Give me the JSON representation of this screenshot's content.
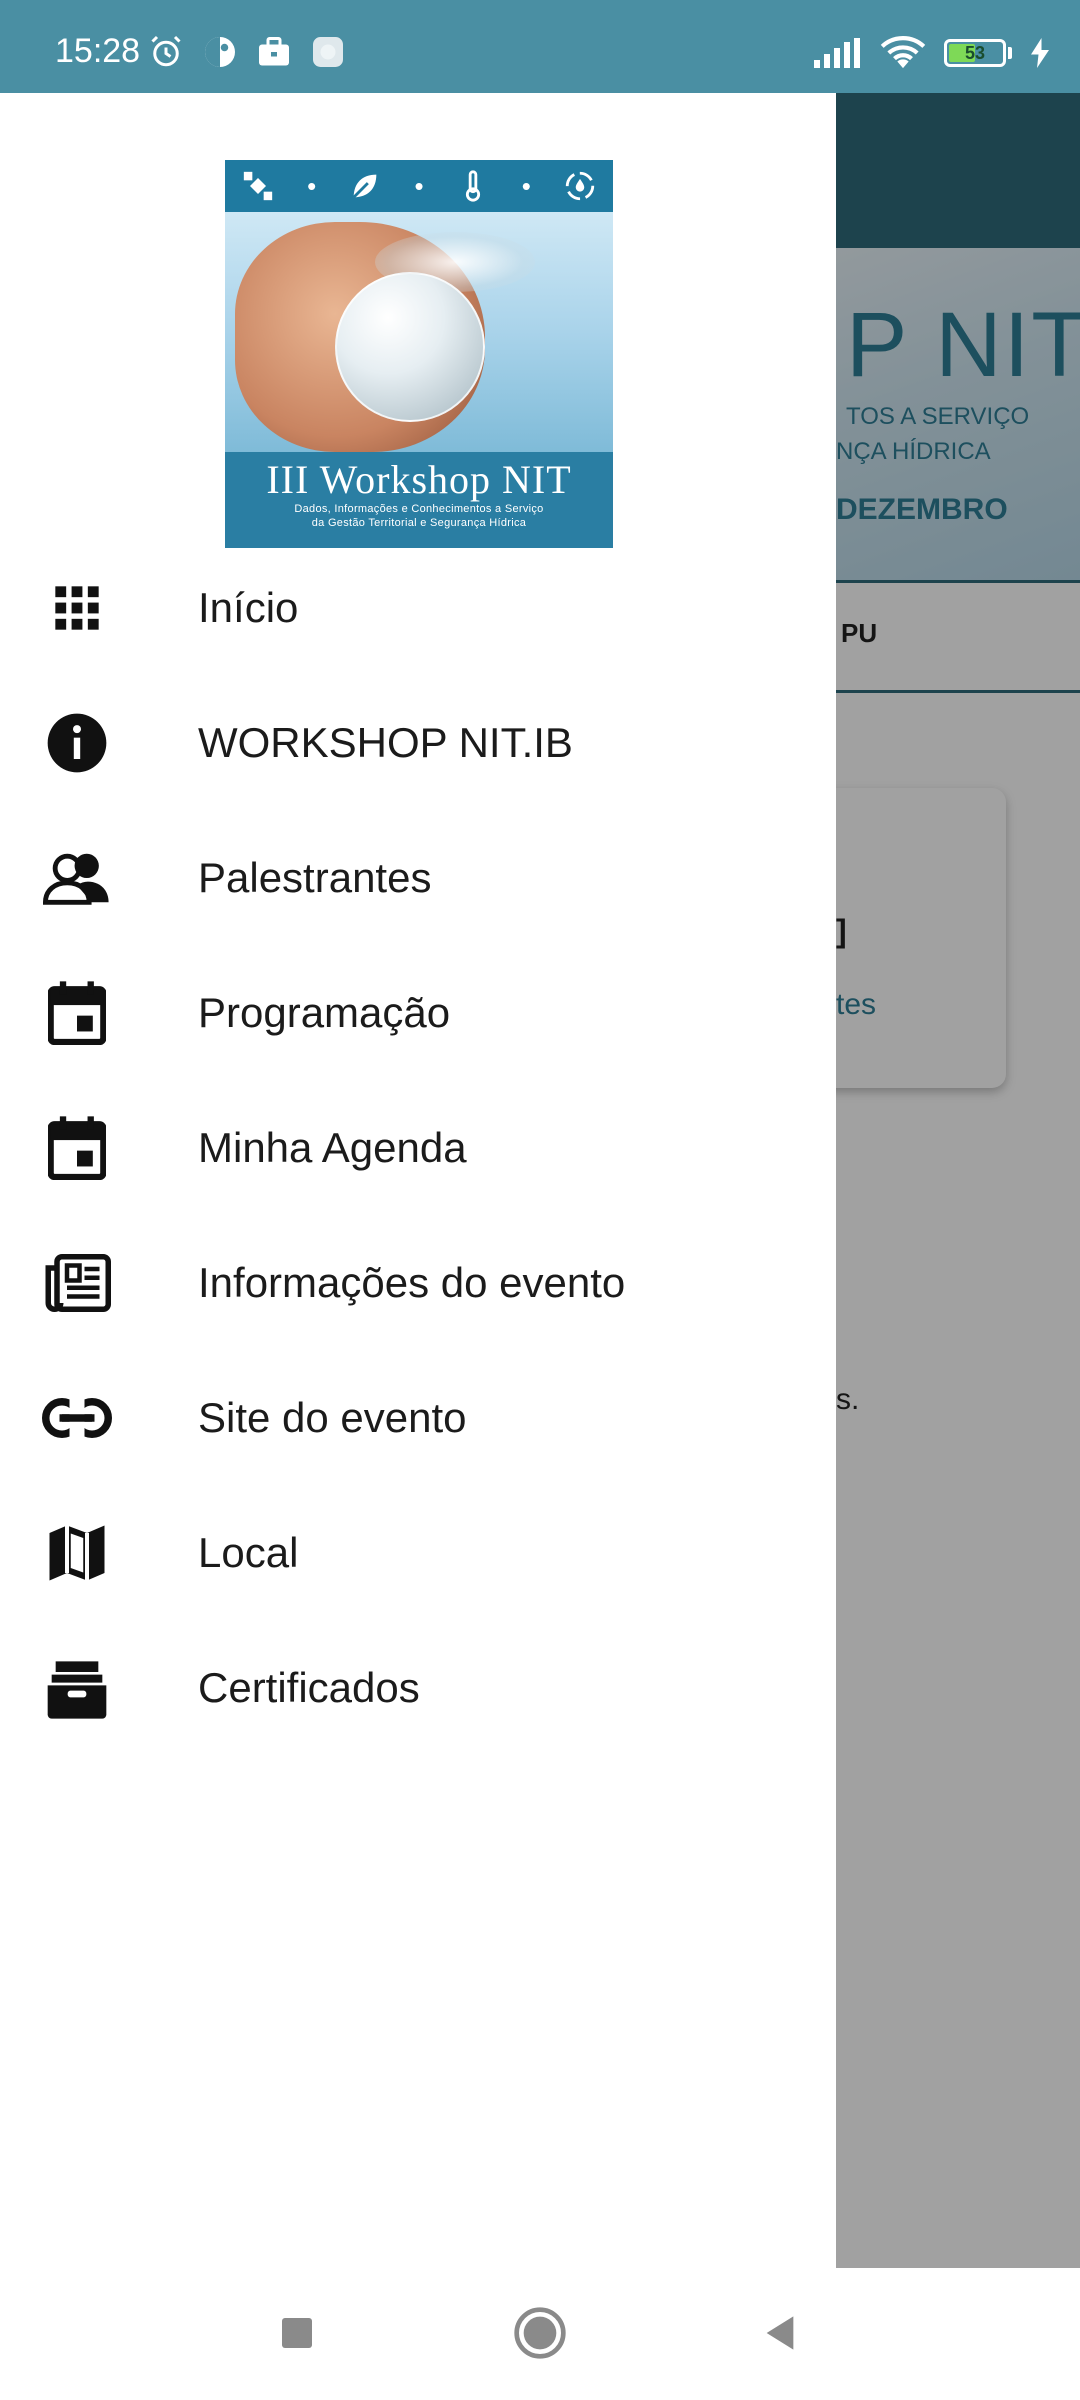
{
  "status_bar": {
    "time": "15:28",
    "battery_level": "53",
    "left_icons": [
      "alarm-icon",
      "app-icon",
      "briefcase-icon",
      "notification-icon"
    ],
    "right_icons": [
      "signal-icon",
      "wifi-icon",
      "battery-icon",
      "charging-icon"
    ]
  },
  "drawer": {
    "logo": {
      "title": "III Workshop NIT",
      "subtitle_line1": "Dados, Informações e Conhecimentos a Serviço",
      "subtitle_line2": "da Gestão Territorial e Segurança Hídrica"
    },
    "items": [
      {
        "label": "Início",
        "icon": "grid-icon"
      },
      {
        "label": "WORKSHOP NIT.IB",
        "icon": "info-icon"
      },
      {
        "label": "Palestrantes",
        "icon": "people-icon"
      },
      {
        "label": "Programação",
        "icon": "calendar-icon"
      },
      {
        "label": "Minha Agenda",
        "icon": "calendar-icon"
      },
      {
        "label": "Informações do evento",
        "icon": "newspaper-icon"
      },
      {
        "label": "Site do evento",
        "icon": "link-icon"
      },
      {
        "label": "Local",
        "icon": "map-icon"
      },
      {
        "label": "Certificados",
        "icon": "archive-icon"
      }
    ]
  },
  "background": {
    "banner_nit": "P NIT",
    "banner_line1": "TOS A SERVIÇO",
    "banner_line2": "NÇA HÍDRICA",
    "banner_date": "DEZEMBRO",
    "logos_text": "PU",
    "card_link": "tes",
    "trailing_text": "s."
  },
  "nav_bar": {
    "buttons": [
      "recents-button",
      "home-button",
      "back-button"
    ]
  },
  "colors": {
    "status_bar": "#4a8fa3",
    "app_bar": "#2f6b7a",
    "accent": "#2f7d95"
  }
}
